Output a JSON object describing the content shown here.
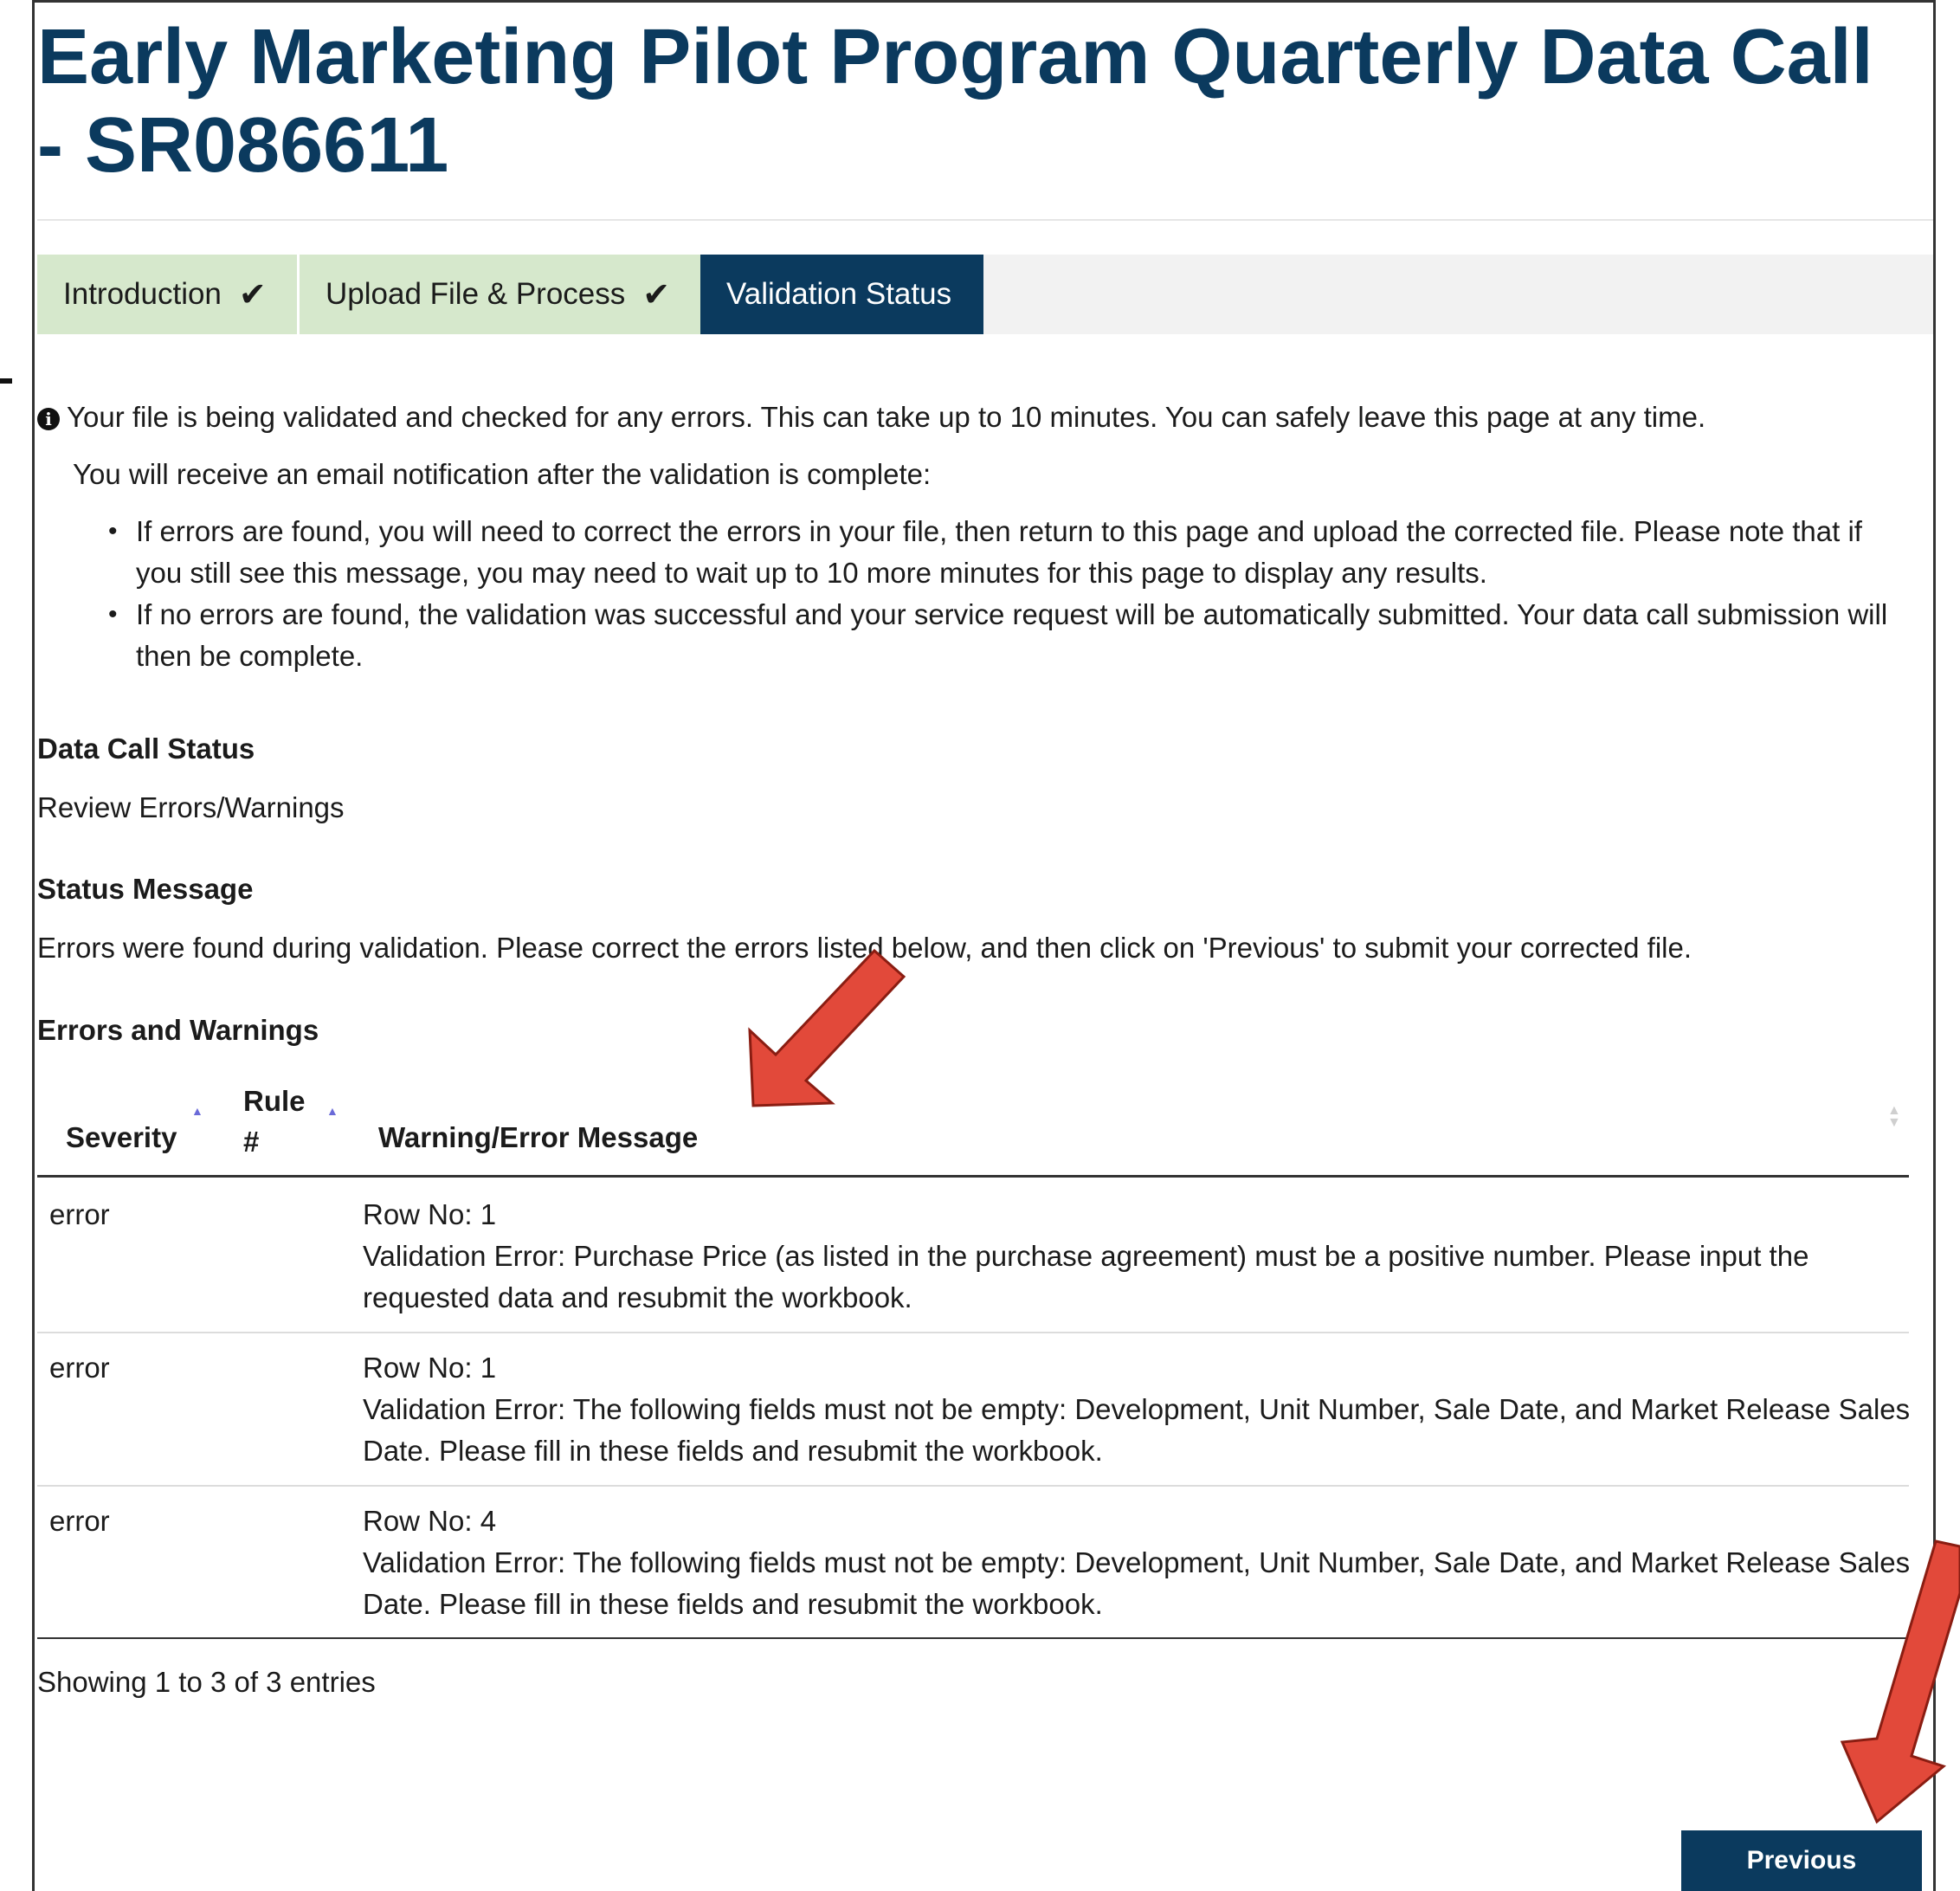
{
  "page": {
    "title": "Early Marketing Pilot Program Quarterly Data Call - SR086611"
  },
  "steps": [
    {
      "label": "Introduction",
      "state": "complete",
      "icon": "checkmark-icon"
    },
    {
      "label": "Upload File & Process",
      "state": "complete",
      "icon": "checkmark-icon"
    },
    {
      "label": "Validation Status",
      "state": "active"
    }
  ],
  "info": {
    "icon": "info-circle-icon",
    "line1": "Your file is being validated and checked for any errors. This can take up to 10 minutes. You can safely leave this page at any time.",
    "line2": "You will receive an email notification after the validation is complete:",
    "bullets": [
      "If errors are found, you will need to correct the errors in your file, then return to this page and upload the corrected file. Please note that if you still see this message, you may need to wait up to 10 more minutes for this page to display any results.",
      "If no errors are found, the validation was successful and your service request will be automatically submitted. Your data call submission will then be complete."
    ]
  },
  "data_call_status": {
    "label": "Data Call Status",
    "value": "Review Errors/Warnings"
  },
  "status_message": {
    "label": "Status Message",
    "value": "Errors were found during validation. Please correct the errors listed below, and then click on 'Previous' to submit your corrected file."
  },
  "errors_table": {
    "label": "Errors and Warnings",
    "columns": [
      "Severity",
      "Rule #",
      "Warning/Error Message"
    ],
    "rows": [
      {
        "severity": "error",
        "rule": "",
        "row_no": "Row No: 1",
        "message": "Validation Error: Purchase Price (as listed in the purchase agreement) must be a positive number. Please input the requested data and resubmit the workbook."
      },
      {
        "severity": "error",
        "rule": "",
        "row_no": "Row No: 1",
        "message": "Validation Error: The following fields must not be empty: Development, Unit Number, Sale Date, and Market Release Sales Date. Please fill in these fields and resubmit the workbook."
      },
      {
        "severity": "error",
        "rule": "",
        "row_no": "Row No: 4",
        "message": "Validation Error: The following fields must not be empty: Development, Unit Number, Sale Date, and Market Release Sales Date. Please fill in these fields and resubmit the workbook."
      }
    ],
    "info": "Showing 1 to 3 of 3 entries"
  },
  "buttons": {
    "previous": "Previous"
  },
  "colors": {
    "brand_navy": "#0b3a5e",
    "step_complete_bg": "#d6e8cc",
    "annotation_arrow": "#e2493a"
  }
}
